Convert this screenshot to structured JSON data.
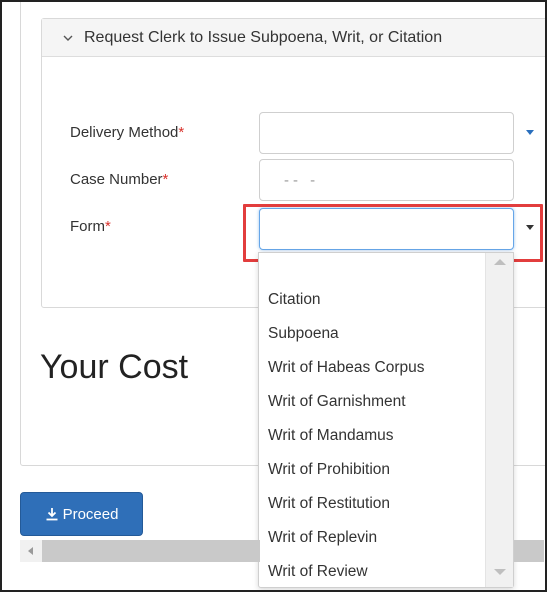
{
  "accordion": {
    "title": "Request Clerk to Issue Subpoena, Writ, or Citation"
  },
  "fields": {
    "delivery_method": {
      "label": "Delivery Method",
      "required_mark": "*",
      "value": ""
    },
    "case_number": {
      "label": "Case Number",
      "required_mark": "*",
      "placeholder": "-- -"
    },
    "form": {
      "label": "Form",
      "required_mark": "*",
      "value": ""
    }
  },
  "cost": {
    "title": "Your Cost"
  },
  "dropdown": {
    "options": [
      "Citation",
      "Subpoena",
      "Writ of Habeas Corpus",
      "Writ of Garnishment",
      "Writ of Mandamus",
      "Writ of Prohibition",
      "Writ of Restitution",
      "Writ of Replevin",
      "Writ of Review"
    ]
  },
  "actions": {
    "proceed_label": "Proceed"
  },
  "colors": {
    "accent": "#2f6fb8",
    "required": "#d9312b",
    "highlight": "#e23d3d"
  }
}
